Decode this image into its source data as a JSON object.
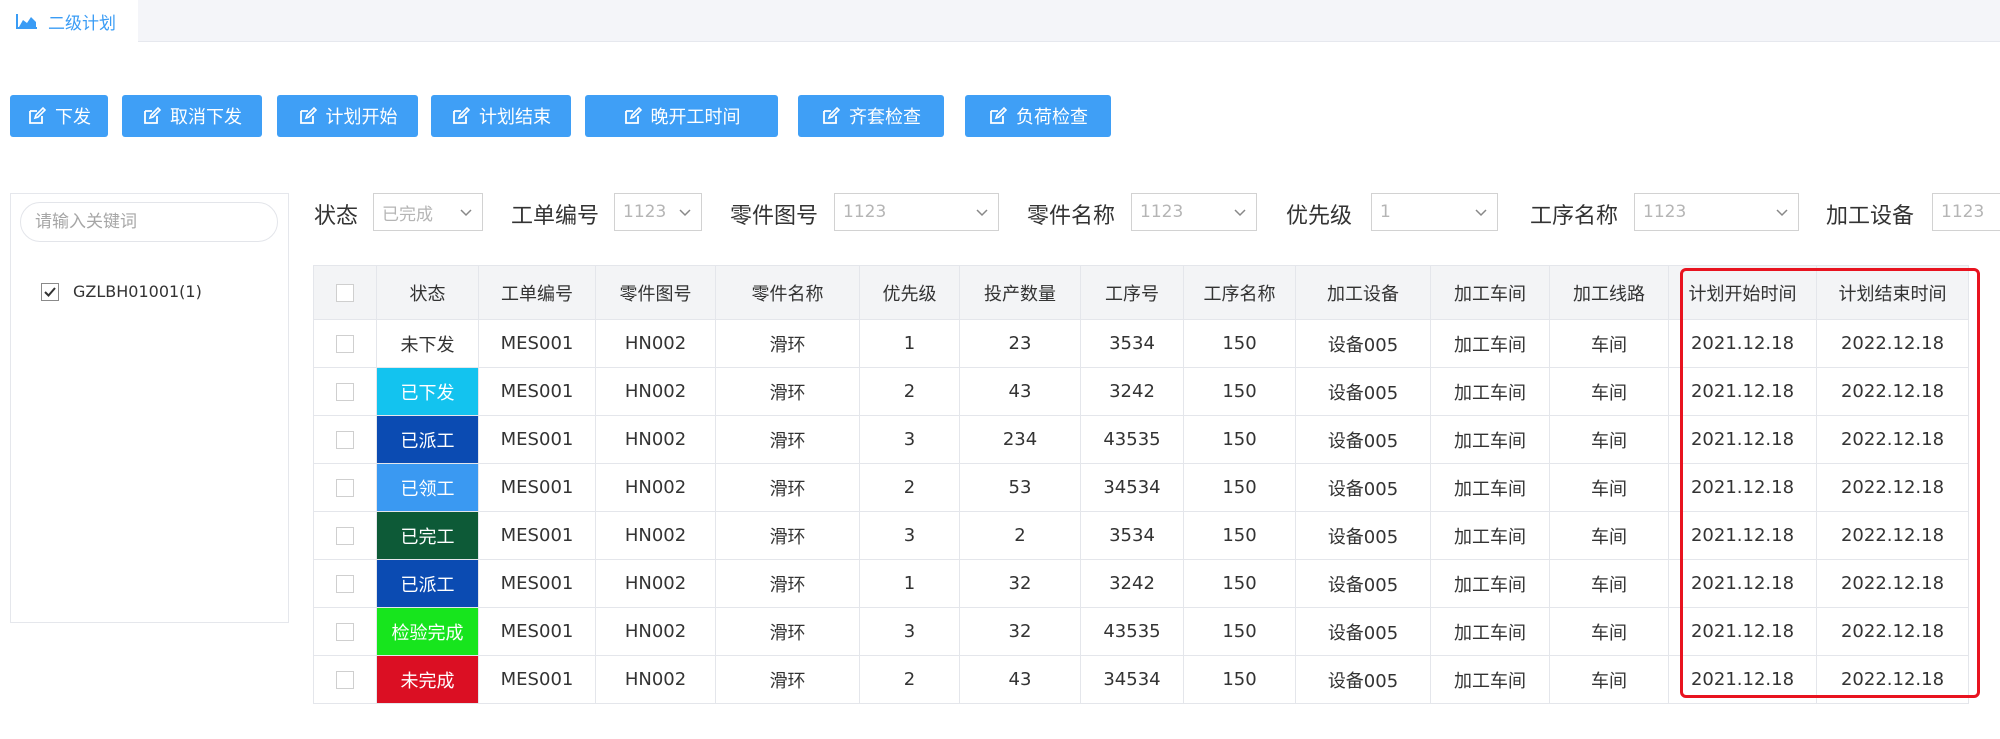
{
  "tab": {
    "label": "二级计划",
    "icon": "area-chart-icon",
    "color": "#3a9cf5"
  },
  "toolbar": {
    "buttons": [
      {
        "label": "下发"
      },
      {
        "label": "取消下发"
      },
      {
        "label": "计划开始"
      },
      {
        "label": "计划结束"
      },
      {
        "label": "晚开工时间"
      },
      {
        "label": "齐套检查"
      },
      {
        "label": "负荷检查"
      }
    ],
    "icon": "edit-icon",
    "color": "#3f9ff6"
  },
  "sidebar": {
    "search_placeholder": "请输入关键词",
    "tree_item": {
      "label": "GZLBH01001(1)",
      "checked": true
    }
  },
  "filters": [
    {
      "label": "状态",
      "value": "已完成"
    },
    {
      "label": "工单编号",
      "value": "1123"
    },
    {
      "label": "零件图号",
      "value": "1123"
    },
    {
      "label": "零件名称",
      "value": "1123"
    },
    {
      "label": "优先级",
      "value": "1"
    },
    {
      "label": "工序名称",
      "value": "1123"
    },
    {
      "label": "加工设备",
      "value": "1123"
    }
  ],
  "table": {
    "headers": [
      "状态",
      "工单编号",
      "零件图号",
      "零件名称",
      "优先级",
      "投产数量",
      "工序号",
      "工序名称",
      "加工设备",
      "加工车间",
      "加工线路",
      "计划开始时间",
      "计划结束时间"
    ],
    "rows": [
      {
        "status": "未下发",
        "status_color": "#ffffff",
        "cells": [
          "MES001",
          "HN002",
          "滑环",
          "1",
          "23",
          "3534",
          "150",
          "设备005",
          "加工车间",
          "车间",
          "2021.12.18",
          "2022.12.18"
        ]
      },
      {
        "status": "已下发",
        "status_color": "#13c3ef",
        "cells": [
          "MES001",
          "HN002",
          "滑环",
          "2",
          "43",
          "3242",
          "150",
          "设备005",
          "加工车间",
          "车间",
          "2021.12.18",
          "2022.12.18"
        ]
      },
      {
        "status": "已派工",
        "status_color": "#0b4bb2",
        "cells": [
          "MES001",
          "HN002",
          "滑环",
          "3",
          "234",
          "43535",
          "150",
          "设备005",
          "加工车间",
          "车间",
          "2021.12.18",
          "2022.12.18"
        ]
      },
      {
        "status": "已领工",
        "status_color": "#3a99f2",
        "cells": [
          "MES001",
          "HN002",
          "滑环",
          "2",
          "53",
          "34534",
          "150",
          "设备005",
          "加工车间",
          "车间",
          "2021.12.18",
          "2022.12.18"
        ]
      },
      {
        "status": "已完工",
        "status_color": "#0d5a37",
        "cells": [
          "MES001",
          "HN002",
          "滑环",
          "3",
          "2",
          "3534",
          "150",
          "设备005",
          "加工车间",
          "车间",
          "2021.12.18",
          "2022.12.18"
        ]
      },
      {
        "status": "已派工",
        "status_color": "#0b4bb2",
        "cells": [
          "MES001",
          "HN002",
          "滑环",
          "1",
          "32",
          "3242",
          "150",
          "设备005",
          "加工车间",
          "车间",
          "2021.12.18",
          "2022.12.18"
        ]
      },
      {
        "status": "检验完成",
        "status_color": "#17e51d",
        "cells": [
          "MES001",
          "HN002",
          "滑环",
          "3",
          "32",
          "43535",
          "150",
          "设备005",
          "加工车间",
          "车间",
          "2021.12.18",
          "2022.12.18"
        ]
      },
      {
        "status": "未完成",
        "status_color": "#db0f23",
        "cells": [
          "MES001",
          "HN002",
          "滑环",
          "2",
          "43",
          "34534",
          "150",
          "设备005",
          "加工车间",
          "车间",
          "2021.12.18",
          "2022.12.18"
        ]
      }
    ]
  },
  "highlight_color": "#e8131f"
}
